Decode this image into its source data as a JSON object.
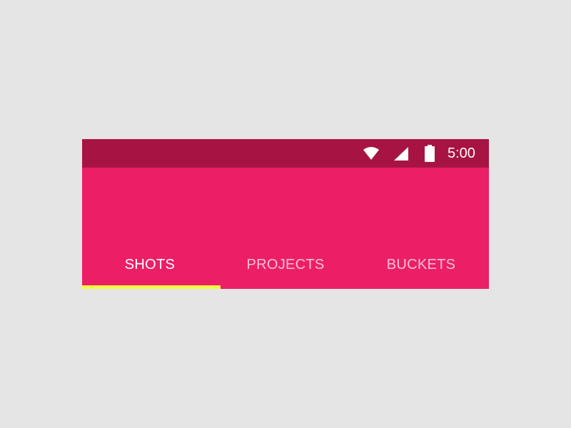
{
  "status_bar": {
    "time": "5:00",
    "icons": [
      "wifi-icon",
      "cellular-signal-icon",
      "battery-icon"
    ],
    "background": "#a71443"
  },
  "app_bar": {
    "background": "#ec1f66"
  },
  "tabs": {
    "items": [
      {
        "label": "SHOTS",
        "active": true
      },
      {
        "label": "PROJECTS",
        "active": false
      },
      {
        "label": "BUCKETS",
        "active": false
      }
    ],
    "indicator_color": "#eeff41"
  },
  "colors": {
    "page_background": "#e5e5e5",
    "text": "#ffffff"
  }
}
